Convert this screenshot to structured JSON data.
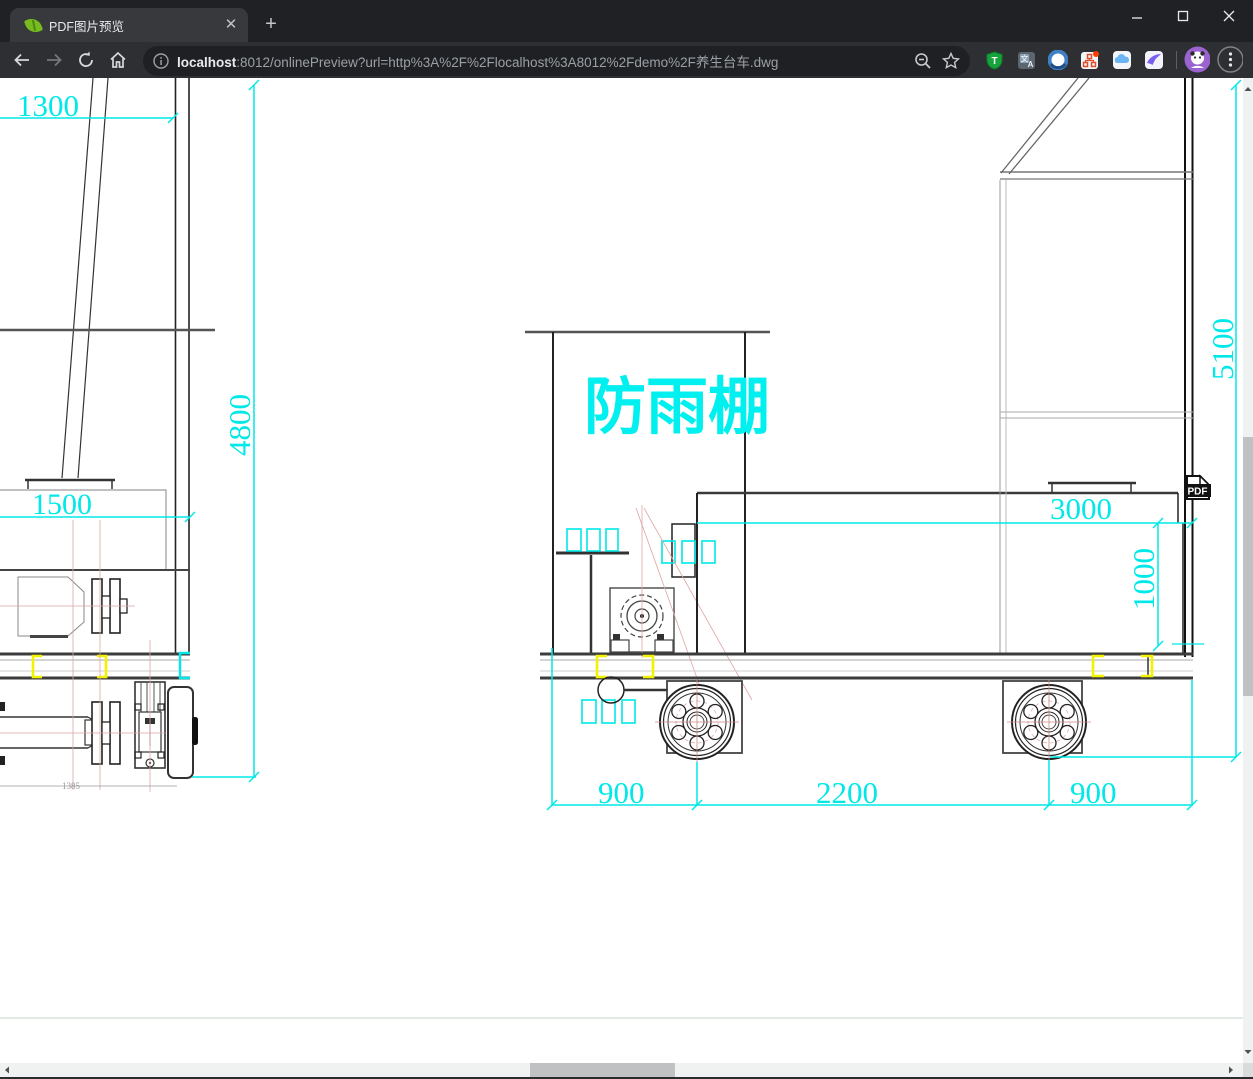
{
  "browser": {
    "tab": {
      "title": "PDF图片预览",
      "close_glyph": "✕",
      "favicon": "spring-leaf-icon"
    },
    "new_tab_glyph": "+",
    "window_controls": {
      "minimize": "minimize-icon",
      "maximize": "maximize-icon",
      "close": "close-icon"
    },
    "nav": {
      "back": "back-arrow-icon",
      "forward": "forward-arrow-icon",
      "reload": "reload-icon",
      "home": "home-icon"
    },
    "address": {
      "info_icon": "info-icon",
      "host": "localhost",
      "rest": ":8012/onlinePreview?url=http%3A%2F%2Flocalhost%3A8012%2Fdemo%2F养生台车.dwg",
      "zoom_icon": "zoom-out-magnifier-icon",
      "bookmark_icon": "star-outline-icon"
    },
    "extensions": [
      "shield-extension-icon",
      "translate-extension-icon",
      "ocean-circle-extension-icon",
      "red-badge-extension-icon",
      "cloud-extension-icon",
      "bird-extension-icon"
    ],
    "profile": "avatar-purple",
    "menu": "three-dot-menu-icon"
  },
  "drawing": {
    "label": "防雨棚",
    "pdf_badge": "PDF",
    "dims": {
      "w1300": "1300",
      "h4800": "4800",
      "w1500": "1500",
      "d1385": "1385",
      "h5100": "5100",
      "w3000": "3000",
      "h1000": "1000",
      "b900l": "900",
      "b2200": "2200",
      "b900r": "900"
    },
    "colors": {
      "dimension": "#00e8e8",
      "highlight": "#f2f200",
      "construction": "#dda5a5",
      "line": "#222222"
    }
  }
}
